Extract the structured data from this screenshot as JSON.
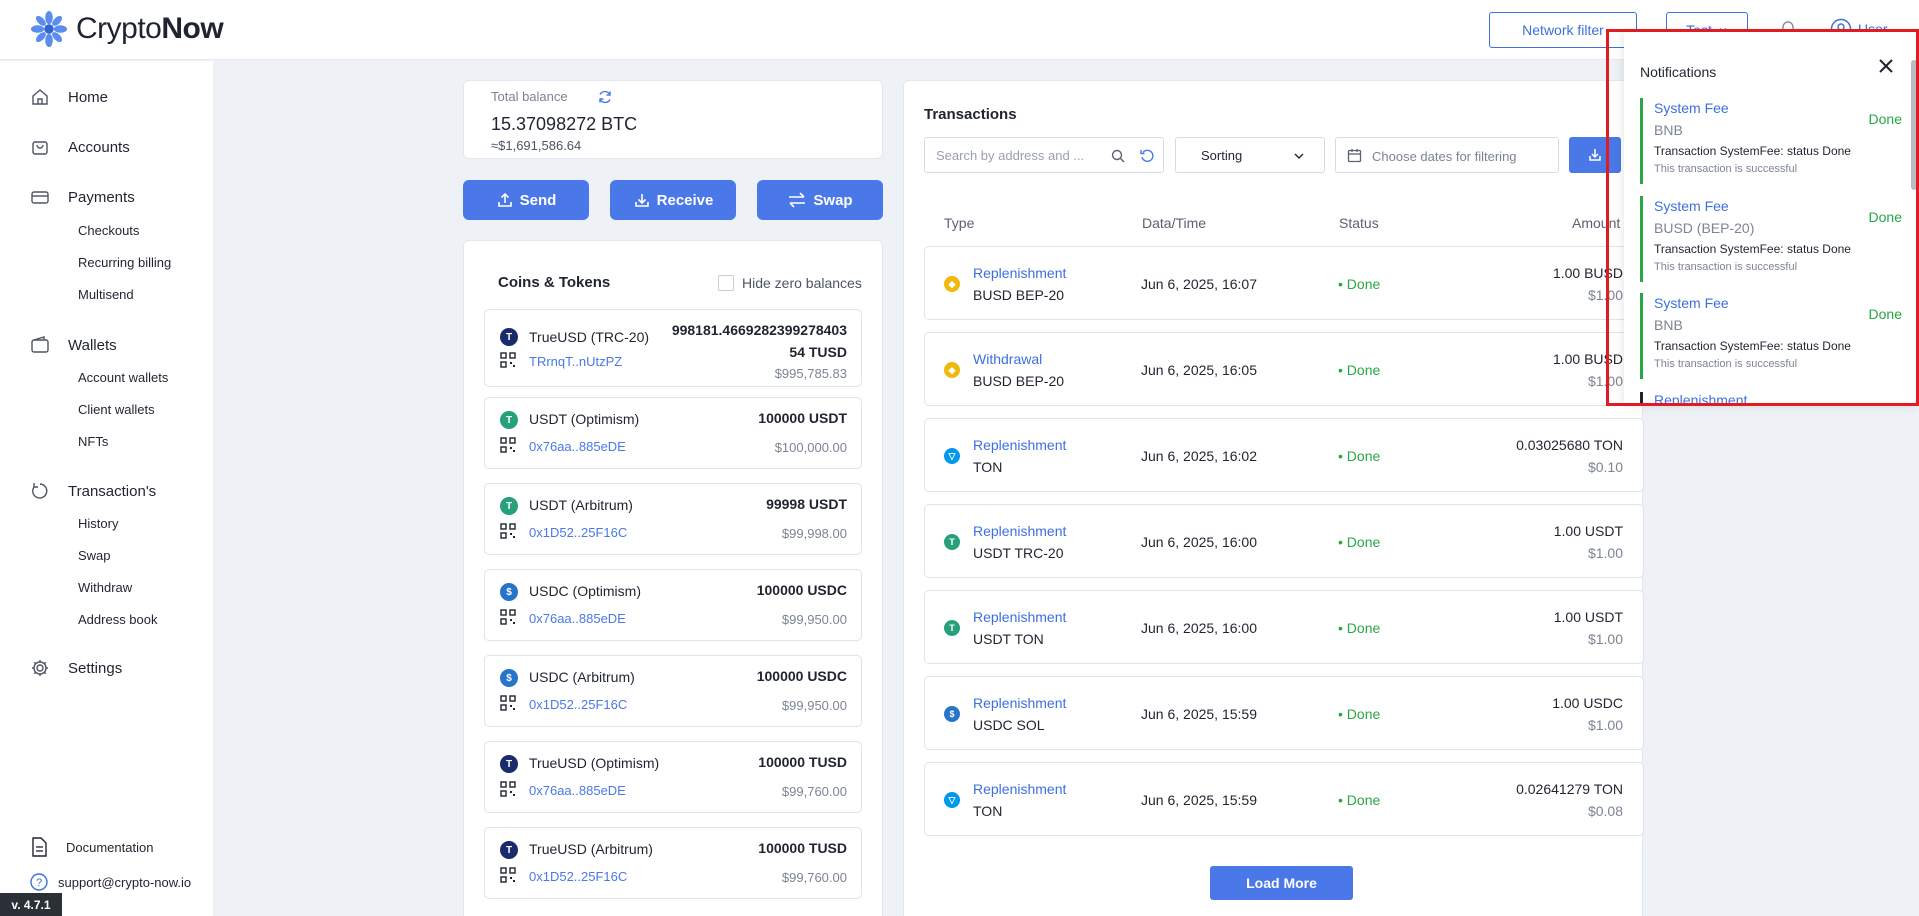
{
  "app": {
    "logo_text_light": "Crypto",
    "logo_text_bold": "Now",
    "version": "v. 4.7.1",
    "accent_color": "#4a78e8",
    "status_color": "#29a745"
  },
  "header": {
    "network_filter_label": "Network filter",
    "test_label": "Test",
    "user_label": "User"
  },
  "sidebar": {
    "items": [
      {
        "label": "Home",
        "icon": "home-icon"
      },
      {
        "label": "Accounts",
        "icon": "bag-icon"
      },
      {
        "label": "Payments",
        "icon": "card-icon"
      },
      {
        "label": "Wallets",
        "icon": "wallet-icon"
      },
      {
        "label": "Transaction's",
        "icon": "history-icon"
      },
      {
        "label": "Settings",
        "icon": "gear-icon"
      }
    ],
    "payments_sub": [
      "Checkouts",
      "Recurring billing",
      "Multisend"
    ],
    "wallets_sub": [
      "Account wallets",
      "Client wallets",
      "NFTs"
    ],
    "transactions_sub": [
      "History",
      "Swap",
      "Withdraw",
      "Address book"
    ],
    "documentation_label": "Documentation",
    "support_email": "support@crypto-now.io"
  },
  "balance": {
    "label": "Total balance",
    "value": "15.37098272 BTC",
    "fiat": "≈$1,691,586.64"
  },
  "actions": {
    "send": "Send",
    "receive": "Receive",
    "swap": "Swap"
  },
  "coins": {
    "title": "Coins & Tokens",
    "hide_zero_label": "Hide zero balances",
    "hide_zero_checked": false,
    "items": [
      {
        "name": "TrueUSD (TRC-20)",
        "address": "TRrnqT..nUtzPZ",
        "amount_line1": "998181.4669282399278403",
        "amount_line2": "54 TUSD",
        "fiat": "$995,785.83",
        "icon": "trueusd-icon"
      },
      {
        "name": "USDT (Optimism)",
        "address": "0x76aa..885eDE",
        "amount": "100000 USDT",
        "fiat": "$100,000.00",
        "icon": "tether-icon"
      },
      {
        "name": "USDT (Arbitrum)",
        "address": "0x1D52..25F16C",
        "amount": "99998 USDT",
        "fiat": "$99,998.00",
        "icon": "tether-icon"
      },
      {
        "name": "USDC (Optimism)",
        "address": "0x76aa..885eDE",
        "amount": "100000 USDC",
        "fiat": "$99,950.00",
        "icon": "usdc-icon"
      },
      {
        "name": "USDC (Arbitrum)",
        "address": "0x1D52..25F16C",
        "amount": "100000 USDC",
        "fiat": "$99,950.00",
        "icon": "usdc-icon"
      },
      {
        "name": "TrueUSD (Optimism)",
        "address": "0x76aa..885eDE",
        "amount": "100000 TUSD",
        "fiat": "$99,760.00",
        "icon": "trueusd-icon"
      },
      {
        "name": "TrueUSD (Arbitrum)",
        "address": "0x1D52..25F16C",
        "amount": "100000 TUSD",
        "fiat": "$99,760.00",
        "icon": "trueusd-icon"
      }
    ]
  },
  "transactions": {
    "title": "Transactions",
    "search_placeholder": "Search by address and ...",
    "sorting_label": "Sorting",
    "dates_placeholder": "Choose dates for filtering",
    "columns": {
      "type": "Type",
      "date": "Data/Time",
      "status": "Status",
      "amount": "Amount"
    },
    "rows": [
      {
        "type": "Replenishment",
        "asset": "BUSD BEP-20",
        "date": "Jun 6, 2025, 16:07",
        "status": "• Done",
        "amount": "1.00 BUSD",
        "fiat": "$1.00",
        "icon": "binance-icon"
      },
      {
        "type": "Withdrawal",
        "asset": "BUSD BEP-20",
        "date": "Jun 6, 2025, 16:05",
        "status": "• Done",
        "amount": "1.00 BUSD",
        "fiat": "$1.00",
        "icon": "binance-icon"
      },
      {
        "type": "Replenishment",
        "asset": "TON",
        "date": "Jun 6, 2025, 16:02",
        "status": "• Done",
        "amount": "0.03025680 TON",
        "fiat": "$0.10",
        "icon": "ton-icon"
      },
      {
        "type": "Replenishment",
        "asset": "USDT TRC-20",
        "date": "Jun 6, 2025, 16:00",
        "status": "• Done",
        "amount": "1.00 USDT",
        "fiat": "$1.00",
        "icon": "tether-icon"
      },
      {
        "type": "Replenishment",
        "asset": "USDT TON",
        "date": "Jun 6, 2025, 16:00",
        "status": "• Done",
        "amount": "1.00 USDT",
        "fiat": "$1.00",
        "icon": "tether-icon"
      },
      {
        "type": "Replenishment",
        "asset": "USDC SOL",
        "date": "Jun 6, 2025, 15:59",
        "status": "• Done",
        "amount": "1.00 USDC",
        "fiat": "$1.00",
        "icon": "usdc-icon"
      },
      {
        "type": "Replenishment",
        "asset": "TON",
        "date": "Jun 6, 2025, 15:59",
        "status": "• Done",
        "amount": "0.02641279 TON",
        "fiat": "$0.08",
        "icon": "ton-icon"
      }
    ],
    "load_more_label": "Load More"
  },
  "notifications": {
    "title": "Notifications",
    "items": [
      {
        "title": "System Fee",
        "asset": "BNB",
        "message": "Transaction SystemFee: status Done",
        "sub": "This transaction is successful",
        "status": "Done"
      },
      {
        "title": "System Fee",
        "asset": "BUSD (BEP-20)",
        "message": "Transaction SystemFee: status Done",
        "sub": "This transaction is successful",
        "status": "Done"
      },
      {
        "title": "System Fee",
        "asset": "BNB",
        "message": "Transaction SystemFee: status Done",
        "sub": "This transaction is successful",
        "status": "Done"
      }
    ],
    "next_partial_title": "Replenishment"
  }
}
